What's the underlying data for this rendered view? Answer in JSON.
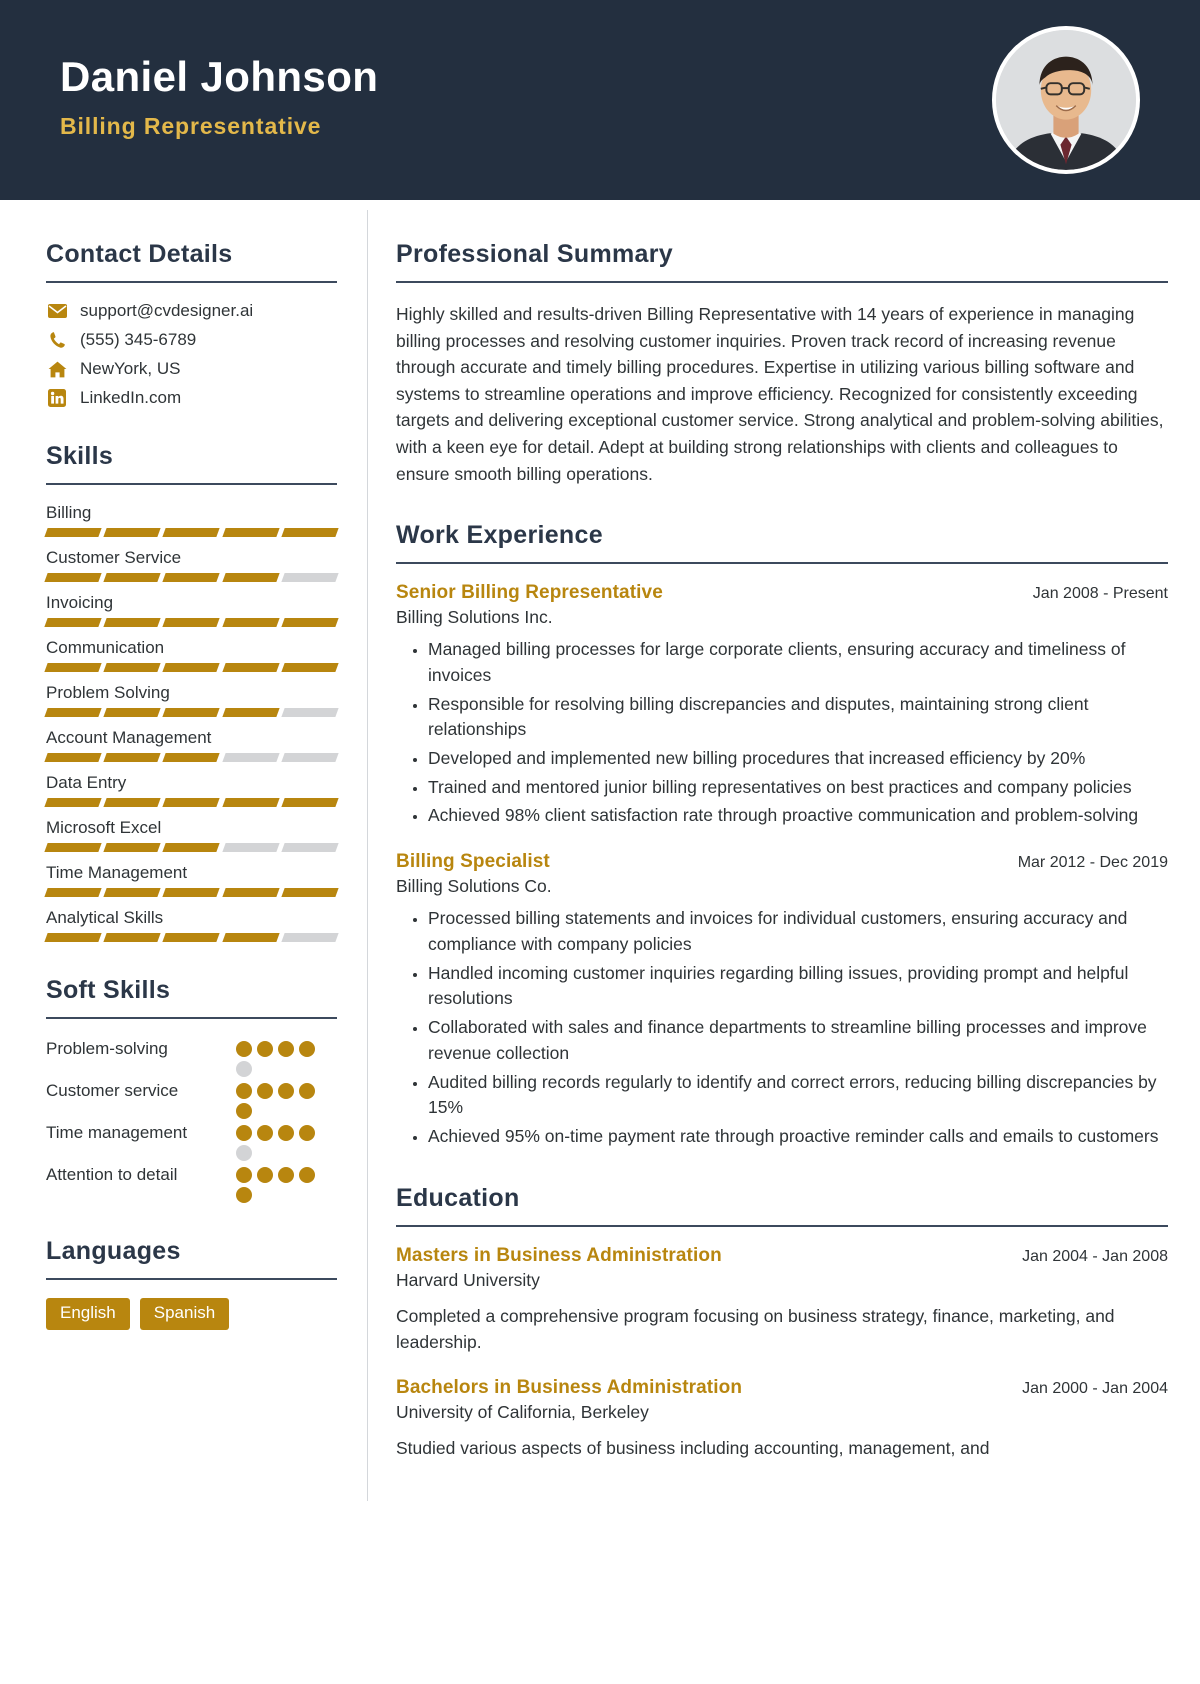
{
  "colors": {
    "header_bg": "#232f3f",
    "accent_gold": "#b8860f",
    "title_gold": "#e3b84a",
    "heading_navy": "#2b3748",
    "text": "#2f3437",
    "muted_bar": "#d3d4d6"
  },
  "header": {
    "name": "Daniel Johnson",
    "job_title": "Billing Representative",
    "avatar_alt": "profile-photo"
  },
  "sidebar": {
    "contact": {
      "heading": "Contact Details",
      "items": [
        {
          "icon": "envelope-icon",
          "value": "support@cvdesigner.ai"
        },
        {
          "icon": "phone-icon",
          "value": "(555) 345-6789"
        },
        {
          "icon": "home-icon",
          "value": "NewYork, US"
        },
        {
          "icon": "linkedin-icon",
          "value": "LinkedIn.com"
        }
      ]
    },
    "skills": {
      "heading": "Skills",
      "max": 5,
      "items": [
        {
          "name": "Billing",
          "level": 5
        },
        {
          "name": "Customer Service",
          "level": 4
        },
        {
          "name": "Invoicing",
          "level": 5
        },
        {
          "name": "Communication",
          "level": 5
        },
        {
          "name": "Problem Solving",
          "level": 4
        },
        {
          "name": "Account Management",
          "level": 3
        },
        {
          "name": "Data Entry",
          "level": 5
        },
        {
          "name": "Microsoft Excel",
          "level": 3
        },
        {
          "name": "Time Management",
          "level": 5
        },
        {
          "name": "Analytical Skills",
          "level": 4
        }
      ]
    },
    "soft_skills": {
      "heading": "Soft Skills",
      "max": 5,
      "items": [
        {
          "name": "Problem-solving",
          "level": 4
        },
        {
          "name": "Customer service",
          "level": 5
        },
        {
          "name": "Time management",
          "level": 4
        },
        {
          "name": "Attention to detail",
          "level": 5
        }
      ]
    },
    "languages": {
      "heading": "Languages",
      "items": [
        "English",
        "Spanish"
      ]
    }
  },
  "main": {
    "summary": {
      "heading": "Professional Summary",
      "text": "Highly skilled and results-driven Billing Representative with 14 years of experience in managing billing processes and resolving customer inquiries. Proven track record of increasing revenue through accurate and timely billing procedures. Expertise in utilizing various billing software and systems to streamline operations and improve efficiency. Recognized for consistently exceeding targets and delivering exceptional customer service. Strong analytical and problem-solving abilities, with a keen eye for detail. Adept at building strong relationships with clients and colleagues to ensure smooth billing operations."
    },
    "experience": {
      "heading": "Work Experience",
      "items": [
        {
          "title": "Senior Billing Representative",
          "date": "Jan 2008 - Present",
          "org": "Billing Solutions Inc.",
          "bullets": [
            "Managed billing processes for large corporate clients, ensuring accuracy and timeliness of invoices",
            "Responsible for resolving billing discrepancies and disputes, maintaining strong client relationships",
            "Developed and implemented new billing procedures that increased efficiency by 20%",
            "Trained and mentored junior billing representatives on best practices and company policies",
            "Achieved 98% client satisfaction rate through proactive communication and problem-solving"
          ]
        },
        {
          "title": "Billing Specialist",
          "date": "Mar 2012 - Dec 2019",
          "org": "Billing Solutions Co.",
          "bullets": [
            "Processed billing statements and invoices for individual customers, ensuring accuracy and compliance with company policies",
            "Handled incoming customer inquiries regarding billing issues, providing prompt and helpful resolutions",
            "Collaborated with sales and finance departments to streamline billing processes and improve revenue collection",
            "Audited billing records regularly to identify and correct errors, reducing billing discrepancies by 15%",
            "Achieved 95% on-time payment rate through proactive reminder calls and emails to customers"
          ]
        }
      ]
    },
    "education": {
      "heading": "Education",
      "items": [
        {
          "title": "Masters in Business Administration",
          "date": "Jan 2004 - Jan 2008",
          "org": "Harvard University",
          "desc": "Completed a comprehensive program focusing on business strategy, finance, marketing, and leadership."
        },
        {
          "title": "Bachelors in Business Administration",
          "date": "Jan 2000 - Jan 2004",
          "org": "University of California, Berkeley",
          "desc": "Studied various aspects of business including accounting, management, and"
        }
      ]
    }
  }
}
